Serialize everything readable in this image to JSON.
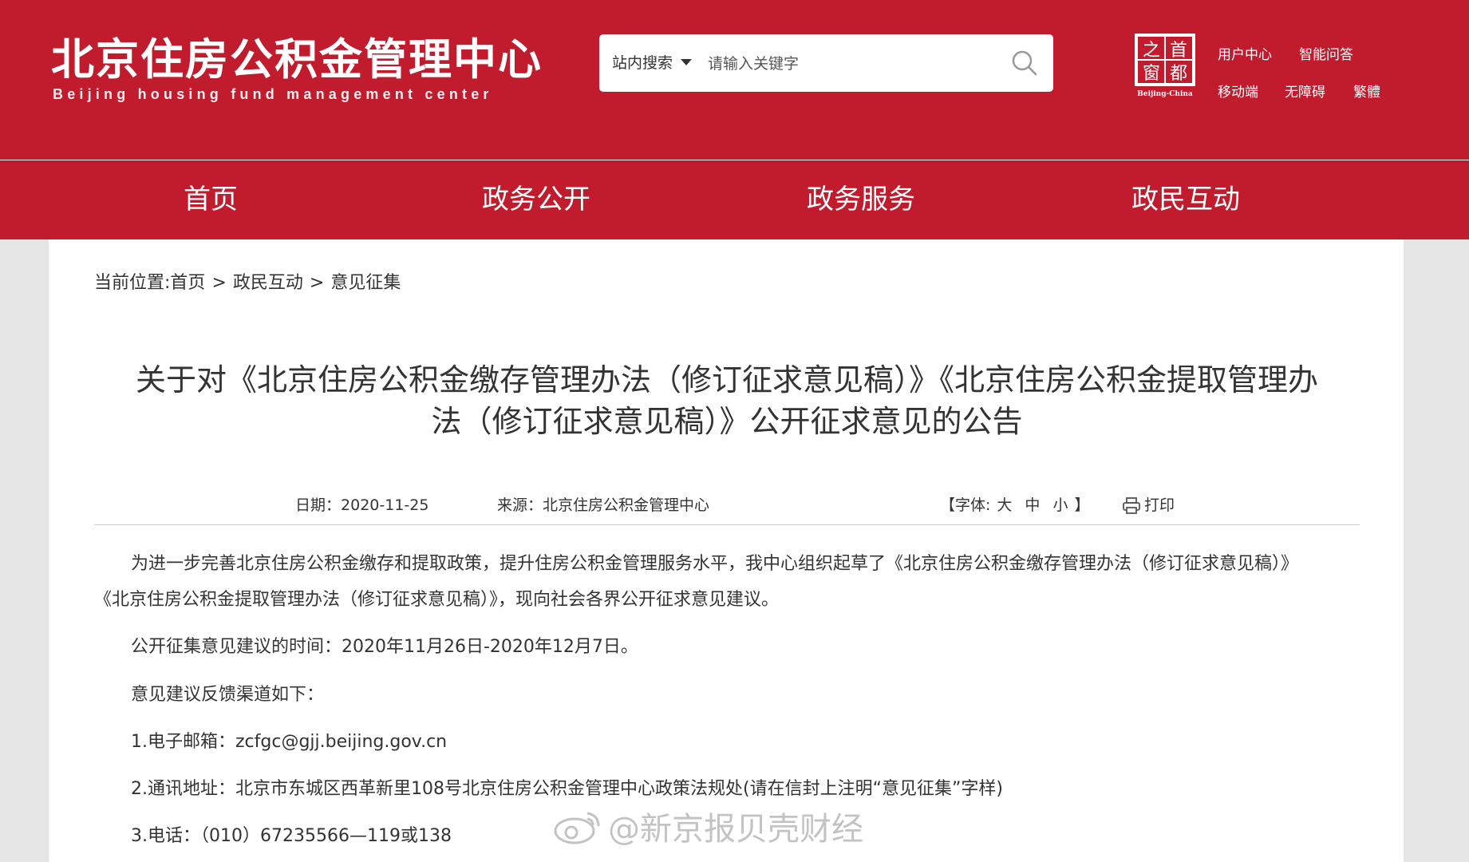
{
  "header": {
    "logo_cn": "北京住房公积金管理中心",
    "logo_en": "Beijing housing fund management center",
    "capital_logo_text": [
      "之",
      "首",
      "窗",
      "都"
    ],
    "capital_logo_caption": "Beijing-China",
    "top_links": [
      "用户中心",
      "智能问答",
      "移动端",
      "无障碍",
      "繁體"
    ]
  },
  "search": {
    "scope": "站内搜索",
    "placeholder": "请输入关键字"
  },
  "nav": [
    "首页",
    "政务公开",
    "政务服务",
    "政民互动"
  ],
  "breadcrumb": {
    "prefix": "当前位置:",
    "items": [
      "首页",
      "政民互动",
      "意见征集"
    ],
    "separator": ">"
  },
  "article": {
    "title_line1": "关于对《北京住房公积金缴存管理办法（修订征求意见稿）》《北京住房公积金提取管理办",
    "title_line2": "法（修订征求意见稿）》公开征求意见的公告",
    "date_label": "日期：",
    "date": "2020-11-25",
    "source_label": "来源：",
    "source": "北京住房公积金管理中心",
    "font_label": "【字体:",
    "font_sizes": [
      "大",
      "中",
      "小"
    ],
    "font_close": "】",
    "print_label": "打印",
    "paragraphs": [
      "为进一步完善北京住房公积金缴存和提取政策，提升住房公积金管理服务水平，我中心组织起草了《北京住房公积金缴存管理办法（修订征求意见稿）》",
      "《北京住房公积金提取管理办法（修订征求意见稿）》，现向社会各界公开征求意见建议。",
      "公开征集意见建议的时间：2020年11月26日-2020年12月7日。",
      "意见建议反馈渠道如下：",
      "1.电子邮箱：zcfgc@gjj.beijing.gov.cn",
      "2.通讯地址：北京市东城区西革新里108号北京住房公积金管理中心政策法规处(请在信封上注明“意见征集”字样)",
      "3.电话：（010）67235566—119或138"
    ]
  },
  "watermark": "@新京报贝壳财经",
  "colors": {
    "brand_red": "#c01c2e",
    "page_bg": "#e6e6e6"
  }
}
